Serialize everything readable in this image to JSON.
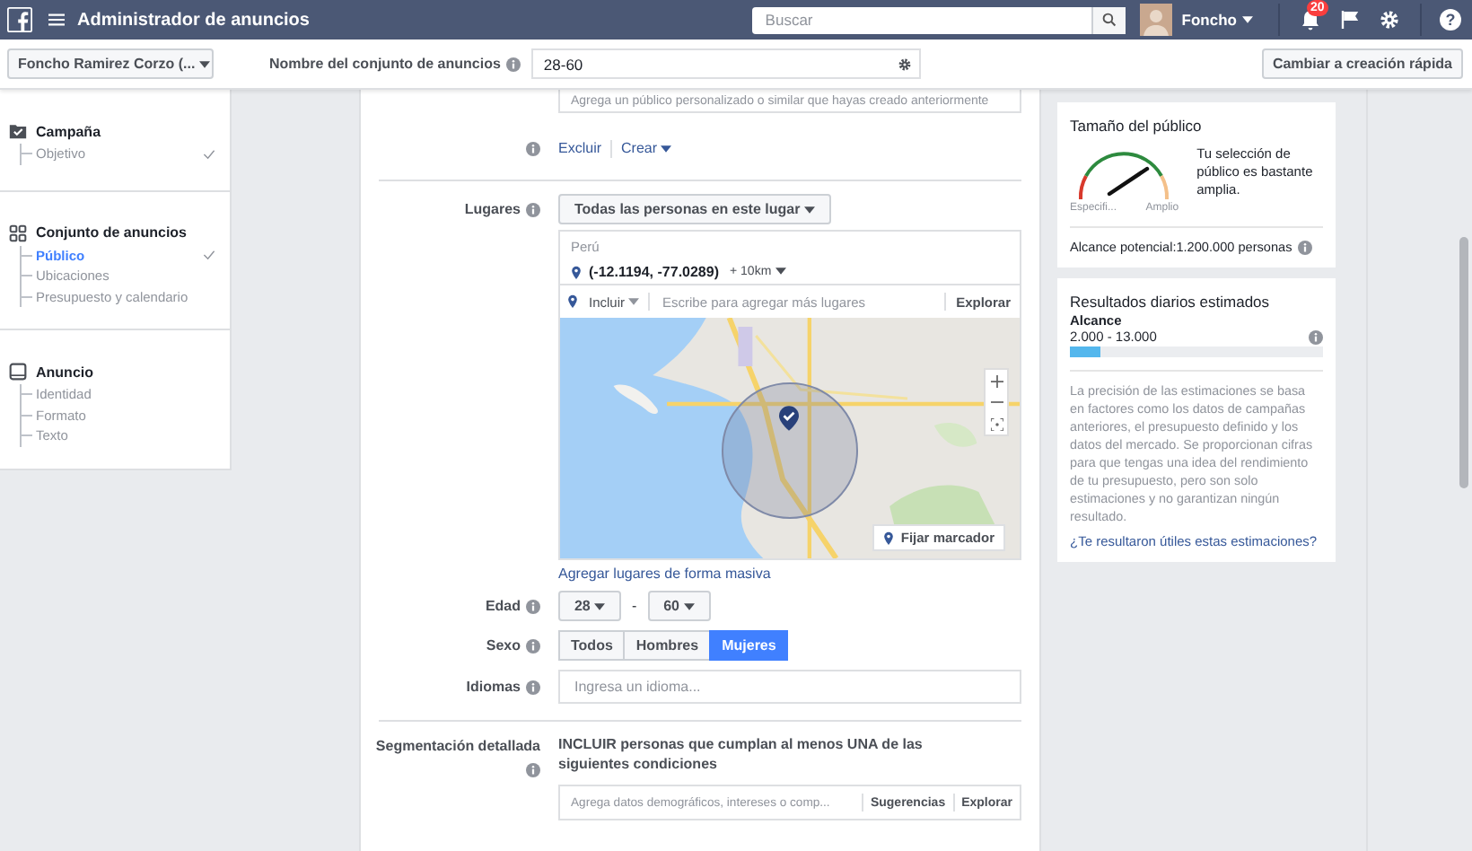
{
  "topbar": {
    "title": "Administrador de anuncios",
    "search": {
      "placeholder": "Buscar"
    },
    "user": "Foncho",
    "notifications": "20",
    "help": "?"
  },
  "subheader": {
    "account": "Foncho Ramirez Corzo (...",
    "name_label": "Nombre del conjunto de anuncios",
    "name_value": "28-60",
    "quick_button": "Cambiar a creación rápida"
  },
  "sidebar": {
    "sections": [
      {
        "kind": "campaign",
        "title": "Campaña",
        "items": [
          {
            "label": "Objetivo",
            "selected": false,
            "checked": true
          }
        ]
      },
      {
        "kind": "adset",
        "title": "Conjunto de anuncios",
        "items": [
          {
            "label": "Público",
            "selected": true,
            "checked": true
          },
          {
            "label": "Ubicaciones",
            "selected": false,
            "checked": false
          },
          {
            "label": "Presupuesto y calendario",
            "selected": false,
            "checked": false
          }
        ]
      },
      {
        "kind": "ad",
        "title": "Anuncio",
        "items": [
          {
            "label": "Identidad",
            "selected": false,
            "checked": false
          },
          {
            "label": "Formato",
            "selected": false,
            "checked": false
          },
          {
            "label": "Texto",
            "selected": false,
            "checked": false
          }
        ]
      }
    ]
  },
  "form": {
    "custom_audience": {
      "placeholder": "Agrega un público personalizado o similar que hayas creado anteriormente",
      "exclude": "Excluir",
      "create": "Crear"
    },
    "locations": {
      "label": "Lugares",
      "mode": "Todas las personas en este lugar",
      "country": "Perú",
      "coordinates": "(-12.1194, -77.0289)",
      "radius": "+ 10km",
      "include": "Incluir",
      "placeholder": "Escribe para agregar más lugares",
      "explore": "Explorar",
      "pin_button": "Fijar marcador",
      "bulk_link": "Agregar lugares de forma masiva"
    },
    "age": {
      "label": "Edad",
      "min": "28",
      "separator": "-",
      "max": "60"
    },
    "gender": {
      "label": "Sexo",
      "options": [
        {
          "label": "Todos",
          "selected": false
        },
        {
          "label": "Hombres",
          "selected": false
        },
        {
          "label": "Mujeres",
          "selected": true
        }
      ]
    },
    "languages": {
      "label": "Idiomas",
      "placeholder": "Ingresa un idioma..."
    },
    "detailed": {
      "label": "Segmentación detallada",
      "description": "INCLUIR personas que cumplan al menos UNA de las siguientes condiciones",
      "placeholder": "Agrega datos demográficos, intereses o comp...",
      "suggestions": "Sugerencias",
      "explore": "Explorar"
    }
  },
  "audience": {
    "title": "Tamaño del público",
    "min_label": "Especifi...",
    "max_label": "Amplio",
    "message": "Tu selección de público es bastante amplia.",
    "reach": "Alcance potencial:1.200.000 personas"
  },
  "estimates": {
    "title": "Resultados diarios estimados",
    "metric": "Alcance",
    "range": "2.000 - 13.000",
    "level": 0.12,
    "note": "La precisión de las estimaciones se basa en factores como los datos de campañas anteriores, el presupuesto definido y los datos del mercado. Se proporcionan cifras para que tengas una idea del rendimiento de tu presupuesto, pero son solo estimaciones y no garantizan ningún resultado.",
    "link": "¿Te resultaron útiles estas estimaciones?"
  }
}
